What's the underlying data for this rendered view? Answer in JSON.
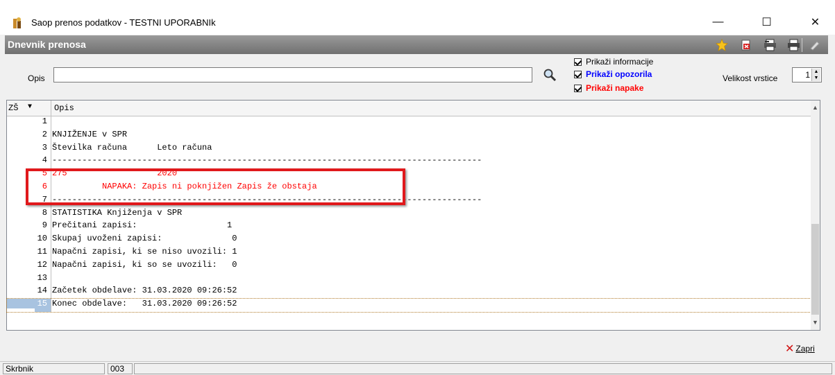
{
  "window": {
    "title": "Saop prenos podatkov - TESTNI UPORABNIk",
    "minimize": "—",
    "maximize": "☐",
    "close": "✕"
  },
  "header": {
    "title": "Dnevnik prenosa",
    "icons": [
      "star-icon",
      "export-icon",
      "print-preview-icon",
      "print-icon",
      "help-icon"
    ]
  },
  "filter": {
    "opis_label": "Opis",
    "opis_value": "",
    "show_info": "Prikaži informacije",
    "show_warnings": "Prikaži opozorila",
    "show_errors": "Prikaži napake",
    "row_size_label": "Velikost vrstice",
    "row_size_value": "1"
  },
  "colors": {
    "warning": "#0000ff",
    "error": "#ff0000",
    "selected_row": "#a8c3e0",
    "highlight_box": "#e0191c"
  },
  "grid": {
    "col_zs": "ZŠ",
    "col_arrow": "▼",
    "col_opis": "Opis",
    "rows": [
      {
        "n": "1",
        "text": ""
      },
      {
        "n": "2",
        "text": "KNJIŽENJE v SPR"
      },
      {
        "n": "3",
        "text": "Številka računa      Leto računa"
      },
      {
        "n": "4",
        "text": "--------------------------------------------------------------------------------------"
      },
      {
        "n": "5",
        "text": "275                  2020"
      },
      {
        "n": "6",
        "text": "          NAPAKA: Zapis ni poknjižen Zapis že obstaja"
      },
      {
        "n": "7",
        "text": "--------------------------------------------------------------------------------------"
      },
      {
        "n": "8",
        "text": "STATISTIKA Knjiženja v SPR"
      },
      {
        "n": "9",
        "text": "Prečitani zapisi:                  1"
      },
      {
        "n": "10",
        "text": "Skupaj uvoženi zapisi:              0"
      },
      {
        "n": "11",
        "text": "Napačni zapisi, ki se niso uvozili: 1"
      },
      {
        "n": "12",
        "text": "Napačni zapisi, ki so se uvozili:   0"
      },
      {
        "n": "13",
        "text": ""
      },
      {
        "n": "14",
        "text": "Začetek obdelave: 31.03.2020 09:26:52"
      },
      {
        "n": "15",
        "text": "Konec obdelave:   31.03.2020 09:26:52"
      }
    ]
  },
  "footer": {
    "close_label": "Zapri"
  },
  "statusbar": {
    "user": "Skrbnik",
    "code": "003"
  }
}
